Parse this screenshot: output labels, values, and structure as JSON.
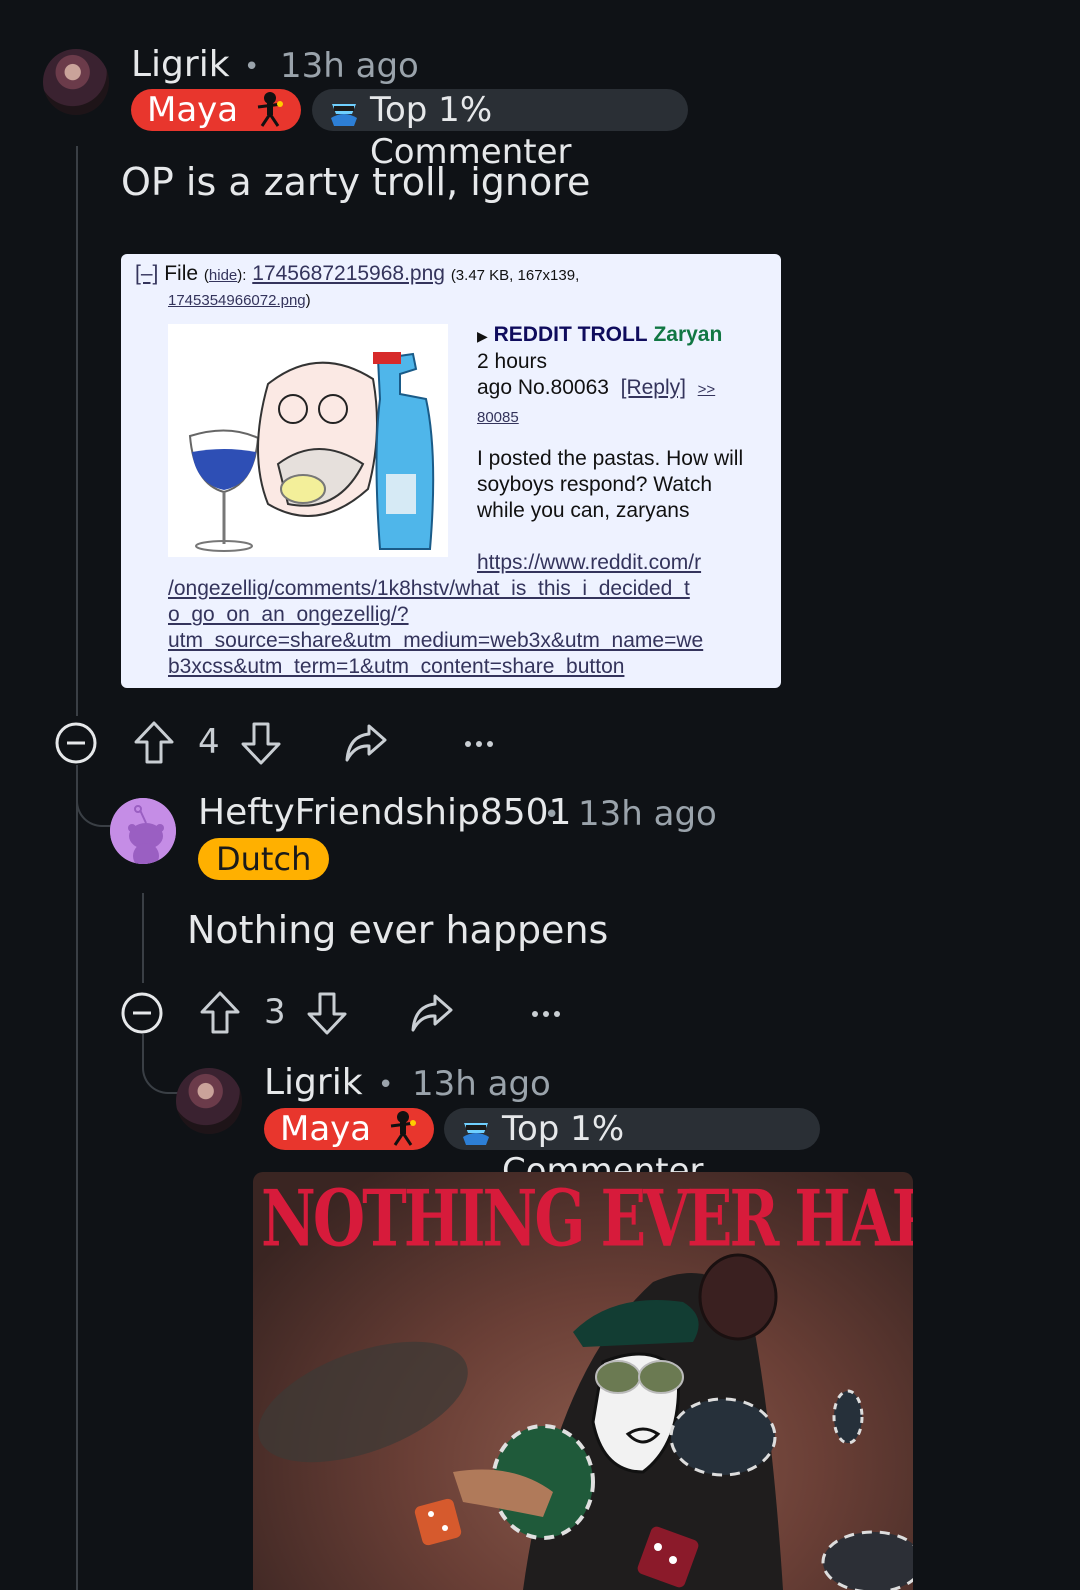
{
  "comment1": {
    "username": "Ligrik",
    "time": "13h ago",
    "flair_maya": "Maya",
    "flair_top": "Top 1% Commenter",
    "body": "OP is a zarty troll, ignore",
    "votes": "4"
  },
  "embed": {
    "toggle": "[–]",
    "file_label": "File",
    "hide_label": "hide",
    "filename": "1745687215968.png",
    "fileinfo": "(3.47 KB, 167x139,",
    "origname": "1745354966072.png",
    "origname_close": ")",
    "subject": "REDDIT TROLL",
    "name": "Zaryan",
    "time_line1": "2 hours",
    "time_line2": "ago No.80063",
    "reply_label": "[Reply]",
    "quote_arrow": ">>",
    "quote_num": "80085",
    "post_text": "I posted the pastas. How will soyboys respond? Watch while you can, zaryans",
    "url_1": "https://www.reddit.com/r",
    "url_2": "/ongezellig/comments/1k8hstv/what_is_this_i_decided_t",
    "url_3": "o_go_on_an_ongezellig/?",
    "url_4": "utm_source=share&utm_medium=web3x&utm_name=we",
    "url_5": "b3xcss&utm_term=1&utm_content=share_button"
  },
  "comment2": {
    "username": "HeftyFriendship8501",
    "time": "13h ago",
    "flair": "Dutch",
    "body": "Nothing ever happens",
    "votes": "3"
  },
  "comment3": {
    "username": "Ligrik",
    "time": "13h ago",
    "flair_maya": "Maya",
    "flair_top": "Top 1% Commenter",
    "meme_title": "NOTHING EVER HAPPENS..."
  },
  "colors": {
    "background": "#0f1216",
    "maya_flair": "#e8362d",
    "dutch_flair": "#ffb000",
    "card_bg": "#eef2ff"
  },
  "icons": [
    "collapse-icon",
    "upvote-icon",
    "downvote-icon",
    "share-icon",
    "more-icon",
    "snoo-avatar-icon",
    "top-commenter-icon",
    "maya-figure-icon"
  ]
}
